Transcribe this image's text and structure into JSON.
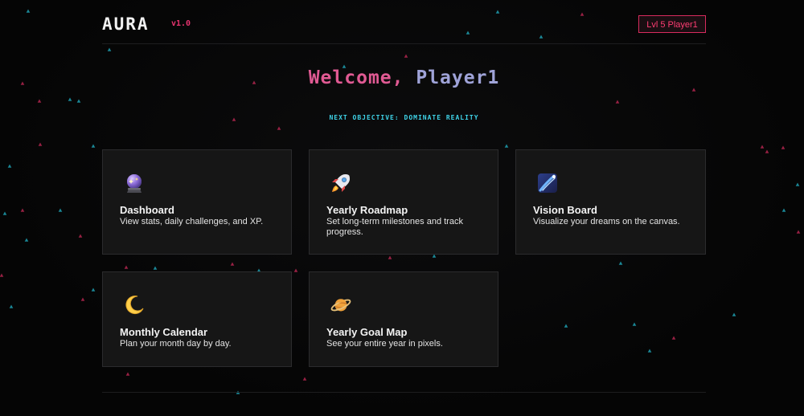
{
  "header": {
    "logo": "AURA",
    "version": "v1.0",
    "player_badge": "Lvl 5 Player1"
  },
  "hero": {
    "greeting": "Welcome,",
    "player_name": "Player1",
    "subtitle": "NEXT OBJECTIVE: DOMINATE REALITY"
  },
  "cards": [
    {
      "icon": "crystal-ball-icon",
      "title": "Dashboard",
      "description": "View stats, daily challenges, and XP."
    },
    {
      "icon": "rocket-icon",
      "title": "Yearly Roadmap",
      "description": "Set long-term milestones and track progress."
    },
    {
      "icon": "shooting-star-icon",
      "title": "Vision Board",
      "description": "Visualize your dreams on the canvas."
    },
    {
      "icon": "crescent-moon-icon",
      "title": "Monthly Calendar",
      "description": "Plan your month day by day."
    },
    {
      "icon": "ringed-planet-icon",
      "title": "Yearly Goal Map",
      "description": "See your entire year in pixels."
    }
  ],
  "colors": {
    "background": "#060606",
    "card": "#161616",
    "accent_pink": "#e05a93",
    "accent_red": "#ff3d73",
    "accent_cyan": "#3fd3e8"
  }
}
